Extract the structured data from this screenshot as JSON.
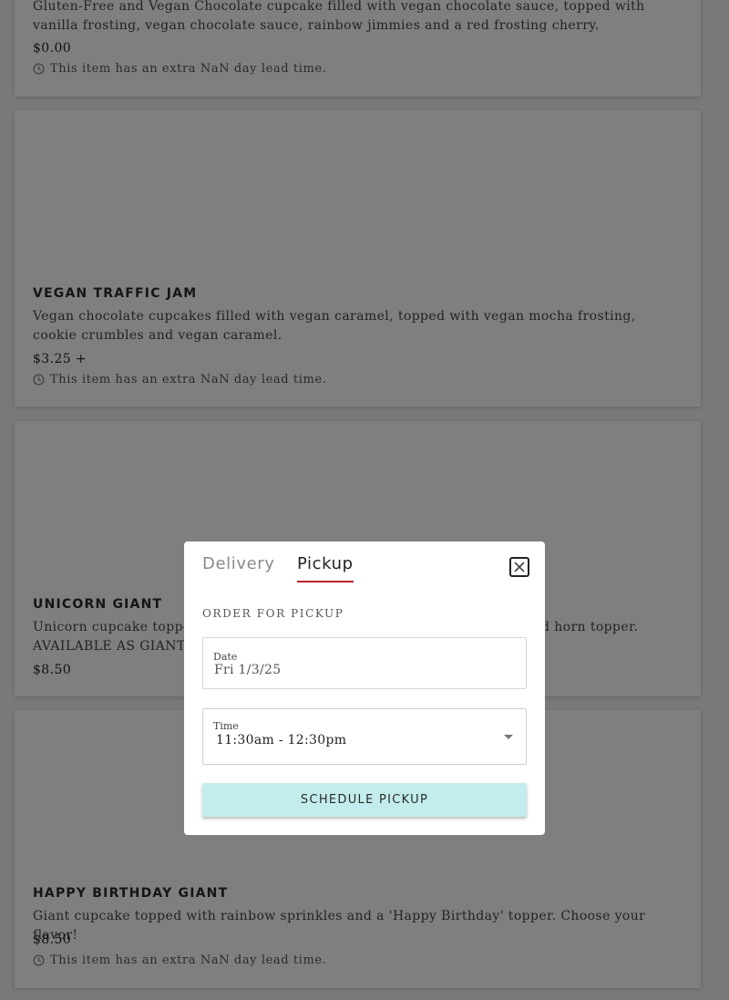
{
  "items": [
    {
      "title": "",
      "description": "Gluten-Free and Vegan Chocolate cupcake filled with vegan chocolate sauce, topped with vanilla frosting, vegan chocolate sauce, rainbow jimmies and a red frosting cherry.",
      "price": "$0.00",
      "lead_time": "This item has an extra NaN day lead time."
    },
    {
      "title": "VEGAN TRAFFIC JAM",
      "description": "Vegan chocolate cupcakes filled with vegan caramel, topped with vegan mocha frosting, cookie crumbles and vegan caramel.",
      "price": "$3.25 +",
      "lead_time": "This item has an extra NaN day lead time."
    },
    {
      "title": "UNICORN GIANT",
      "description_left": "Unicorn cupcake topped w",
      "description_right": "d horn topper.",
      "description_line2": "AVAILABLE AS GIANT",
      "price": "$8.50"
    },
    {
      "title": "HAPPY BIRTHDAY GIANT",
      "description": "Giant cupcake topped with rainbow sprinkles and a 'Happy Birthday' topper. Choose your flavor!",
      "price": "$8.50",
      "lead_time": "This item has an extra NaN day lead time."
    }
  ],
  "modal": {
    "tabs": [
      "Delivery",
      "Pickup"
    ],
    "active_tab": "Pickup",
    "heading": "ORDER FOR PICKUP",
    "date_label": "Date",
    "date_value": "Fri 1/3/25",
    "time_label": "Time",
    "time_value": "11:30am - 12:30pm",
    "submit_label": "SCHEDULE PICKUP",
    "colors": {
      "accent_underline": "#b5222b",
      "button_bg": "#c3edec"
    },
    "icons": [
      "close-icon",
      "chevron-down-icon",
      "clock-icon"
    ]
  }
}
